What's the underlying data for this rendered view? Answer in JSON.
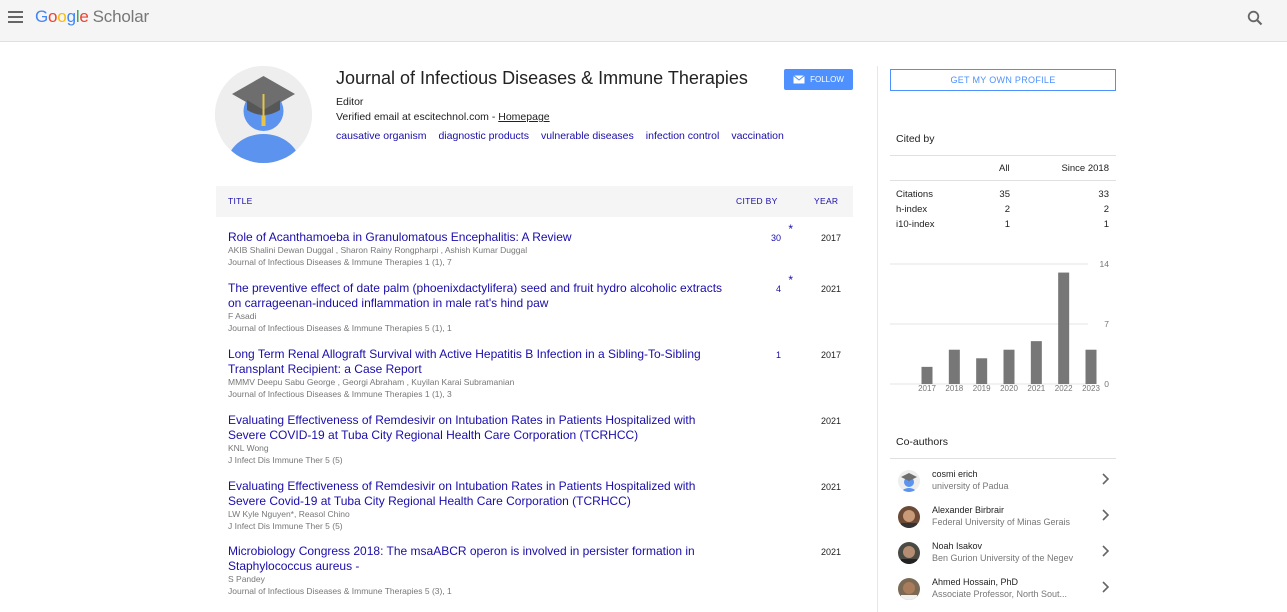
{
  "app": {
    "logo_google": "Google",
    "logo_scholar": "Scholar"
  },
  "profile": {
    "name": "Journal of Infectious Diseases & Immune Therapies",
    "affiliation": "Editor",
    "email_text": "Verified email at escitechnol.com - ",
    "homepage_label": "Homepage",
    "follow_label": "FOLLOW",
    "interests": [
      "causative organism",
      "diagnostic products",
      "vulnerable diseases",
      "infection control",
      "vaccination"
    ]
  },
  "table": {
    "headers": {
      "title": "TITLE",
      "cited_by": "CITED BY",
      "year": "YEAR"
    },
    "rows": [
      {
        "title": "Role of Acanthamoeba in Granulomatous Encephalitis: A Review",
        "authors": "AKIB Shalini Dewan Duggal , Sharon Rainy Rongpharpi , Ashish Kumar Duggal",
        "venue": "Journal of Infectious Diseases & Immune Therapies 1 (1), 7",
        "cited": "30",
        "star": "*",
        "year": "2017"
      },
      {
        "title": "The preventive effect of date palm (phoenixdactylifera) seed and fruit hydro alcoholic extracts on carrageenan-induced inflammation in male rat's hind paw",
        "authors": "F Asadi",
        "venue": "Journal of Infectious Diseases & Immune Therapies 5 (1), 1",
        "cited": "4",
        "star": "*",
        "year": "2021"
      },
      {
        "title": "Long Term Renal Allograft Survival with Active Hepatitis B Infection in a Sibling-To-Sibling Transplant Recipient: a Case Report",
        "authors": "MMMV Deepu Sabu George , Georgi Abraham , Kuyilan Karai Subramanian",
        "venue": "Journal of Infectious Diseases & Immune Therapies 1 (1), 3",
        "cited": "1",
        "star": "",
        "year": "2017"
      },
      {
        "title": "Evaluating Effectiveness of Remdesivir on Intubation Rates in Patients Hospitalized with Severe COVID-19 at Tuba City Regional Health Care Corporation (TCRHCC)",
        "authors": "KNL Wong",
        "venue": "J Infect Dis Immune Ther 5 (5)",
        "cited": "",
        "star": "",
        "year": "2021"
      },
      {
        "title": "Evaluating Effectiveness of Remdesivir on Intubation Rates in Patients Hospitalized with Severe Covid-19 at Tuba City Regional Health Care Corporation (TCRHCC)",
        "authors": "LW Kyle Nguyen*, Reasol Chino",
        "venue": "J Infect Dis Immune Ther 5 (5)",
        "cited": "",
        "star": "",
        "year": "2021"
      },
      {
        "title": "Microbiology Congress 2018: The msaABCR operon is involved in persister formation in Staphylococcus aureus -",
        "authors": "S Pandey",
        "venue": "Journal of Infectious Diseases & Immune Therapies 5 (3), 1",
        "cited": "",
        "star": "",
        "year": "2021"
      }
    ]
  },
  "sidebar": {
    "own_profile_label": "GET MY OWN PROFILE",
    "cited_by_heading": "Cited by",
    "metrics_headers": {
      "all": "All",
      "since": "Since 2018"
    },
    "metrics": [
      {
        "label": "Citations",
        "all": "35",
        "since": "33"
      },
      {
        "label": "h-index",
        "all": "2",
        "since": "2"
      },
      {
        "label": "i10-index",
        "all": "1",
        "since": "1"
      }
    ],
    "coauthors_heading": "Co-authors",
    "coauthors": [
      {
        "name": "cosmi erich",
        "affiliation": "university of Padua"
      },
      {
        "name": "Alexander Birbrair",
        "affiliation": "Federal University of Minas Gerais"
      },
      {
        "name": "Noah Isakov",
        "affiliation": "Ben Gurion University of the Negev"
      },
      {
        "name": "Ahmed Hossain, PhD",
        "affiliation": "Associate Professor, North Sout..."
      }
    ]
  },
  "chart_data": {
    "type": "bar",
    "categories": [
      "2017",
      "2018",
      "2019",
      "2020",
      "2021",
      "2022",
      "2023"
    ],
    "values": [
      2,
      4,
      3,
      4,
      5,
      13,
      4
    ],
    "ylim": [
      0,
      14
    ],
    "yticks": [
      "14",
      "7",
      "0"
    ],
    "bar_color": "#777777"
  }
}
